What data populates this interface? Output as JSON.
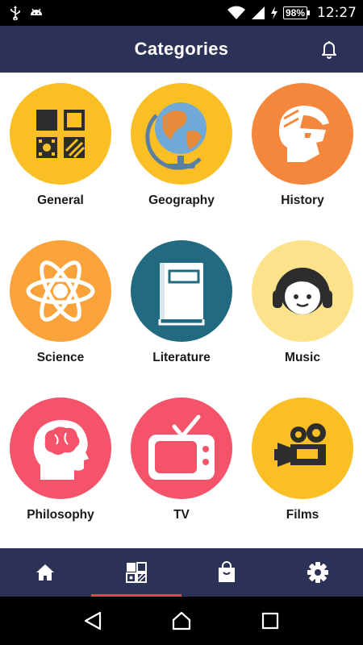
{
  "status_bar": {
    "icons_left": [
      "usb-icon",
      "android-icon"
    ],
    "icons_right": [
      "wifi-icon",
      "signal-icon",
      "charging-icon"
    ],
    "battery": "98%",
    "time": "12:27"
  },
  "app_bar": {
    "title": "Categories",
    "action_icon": "bell-icon"
  },
  "categories": [
    {
      "label": "General",
      "color": "#fbbf26",
      "icon": "grid-squares-icon"
    },
    {
      "label": "Geography",
      "color": "#fbbf26",
      "icon": "globe-icon"
    },
    {
      "label": "History",
      "color": "#f5873d",
      "icon": "spartan-helmet-icon"
    },
    {
      "label": "Science",
      "color": "#f9a33a",
      "icon": "atom-icon"
    },
    {
      "label": "Literature",
      "color": "#216a80",
      "icon": "book-icon"
    },
    {
      "label": "Music",
      "color": "#fde28c",
      "icon": "headphones-face-icon"
    },
    {
      "label": "Philosophy",
      "color": "#f4536a",
      "icon": "head-brain-icon"
    },
    {
      "label": "TV",
      "color": "#f4536a",
      "icon": "television-icon"
    },
    {
      "label": "Films",
      "color": "#fbbf26",
      "icon": "film-camera-icon"
    }
  ],
  "bottom_nav": {
    "items": [
      {
        "icon": "home-icon",
        "active": false
      },
      {
        "icon": "categories-icon",
        "active": true
      },
      {
        "icon": "shopping-bag-icon",
        "active": false
      },
      {
        "icon": "settings-icon",
        "active": false
      }
    ],
    "active_indicator_color": "#e8454f"
  },
  "system_nav": [
    "back-icon",
    "home-circle-icon",
    "recents-icon"
  ],
  "colors": {
    "app_bar": "#2c3257",
    "status_bar": "#000000"
  }
}
